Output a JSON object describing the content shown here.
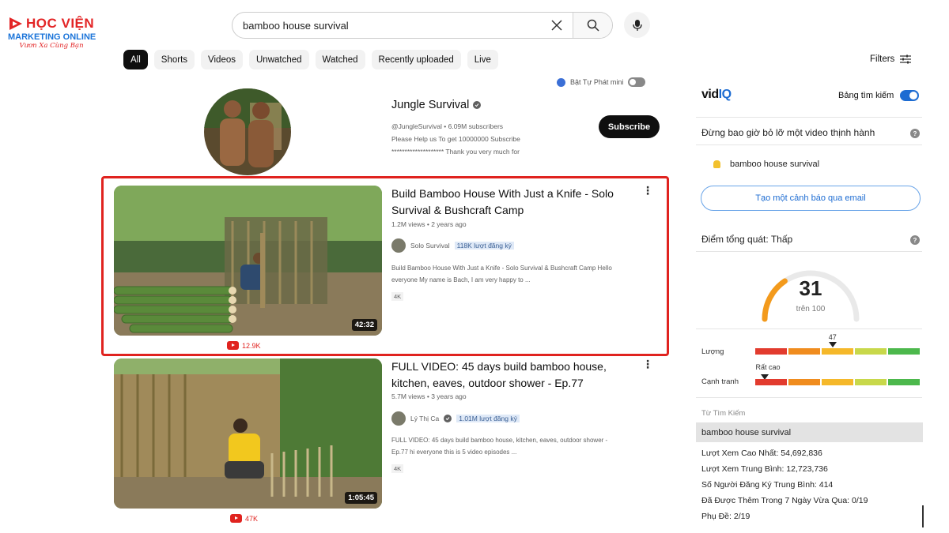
{
  "logo": {
    "line1": "HỌC VIỆN",
    "line2": "MARKETING ONLINE",
    "tagline": "Vươn Xa Cùng Bạn"
  },
  "search": {
    "query": "bamboo house survival"
  },
  "chips": [
    "All",
    "Shorts",
    "Videos",
    "Unwatched",
    "Watched",
    "Recently uploaded",
    "Live"
  ],
  "filters_label": "Filters",
  "safe_mode_label": "Bật Tự Phát mini",
  "channel": {
    "name": "Jungle Survival",
    "handle_subs": "@JungleSurvival • 6.09M subscribers",
    "desc_line1": "Please Help us To get 10000000 Subscribe",
    "desc_line2": "******************** Thank you very much for",
    "subscribe_label": "Subscribe"
  },
  "videos": [
    {
      "title": "Build Bamboo House With Just a Knife - Solo Survival & Bushcraft Camp",
      "meta": "1.2M views • 2 years ago",
      "channel": "Solo Survival",
      "subs": "118K lượt đăng ký",
      "desc1": "Build Bamboo House With Just a Knife - Solo Survival & Bushcraft Camp Hello",
      "desc2": "everyone My name is Bach, I am very happy to ...",
      "badge": "4K",
      "duration": "42:32",
      "yt_views": "12.9K"
    },
    {
      "title": "FULL VIDEO: 45 days build bamboo house, kitchen, eaves, outdoor shower - Ep.77",
      "meta": "5.7M views • 3 years ago",
      "channel": "Lý Thị Ca",
      "subs": "1.01M lượt đăng ký",
      "desc1": "FULL VIDEO: 45 days build bamboo house, kitchen, eaves, outdoor shower -",
      "desc2": "Ep.77 hi everyone this is 5 video episodes ...",
      "badge": "4K",
      "duration": "1:05:45",
      "yt_views": "47K"
    }
  ],
  "vidiq": {
    "logo_a": "vid",
    "logo_b": "IQ",
    "toggle_label": "Bảng tìm kiếm",
    "trend_title": "Đừng bao giờ bỏ lỡ một video thịnh hành",
    "trend_keyword": "bamboo house survival",
    "alert_button": "Tạo một cảnh báo qua email",
    "score_title": "Điểm tổng quát: Thấp",
    "score": "31",
    "score_sub": "trên 100",
    "score_value": 31,
    "volume_label": "Lượng",
    "volume_value": "47",
    "volume_fraction": 0.47,
    "competition_label": "Cạnh tranh",
    "competition_value": "Rất cao",
    "competition_fraction": 0.06,
    "bar_colors": [
      "#e23b2e",
      "#f08c1e",
      "#f5b82a",
      "#c8d84a",
      "#4cb84c"
    ],
    "keyword_header": "Từ Tìm Kiếm",
    "keyword": "bamboo house survival",
    "stats": [
      "Lượt Xem Cao Nhất: 54,692,836",
      "Lượt Xem Trung Bình: 12,723,736",
      "Số Người Đăng Ký Trung Bình: 414",
      "Đã Được Thêm Trong 7 Ngày Vừa Qua: 0/19",
      "Phụ Đề: 2/19"
    ]
  }
}
